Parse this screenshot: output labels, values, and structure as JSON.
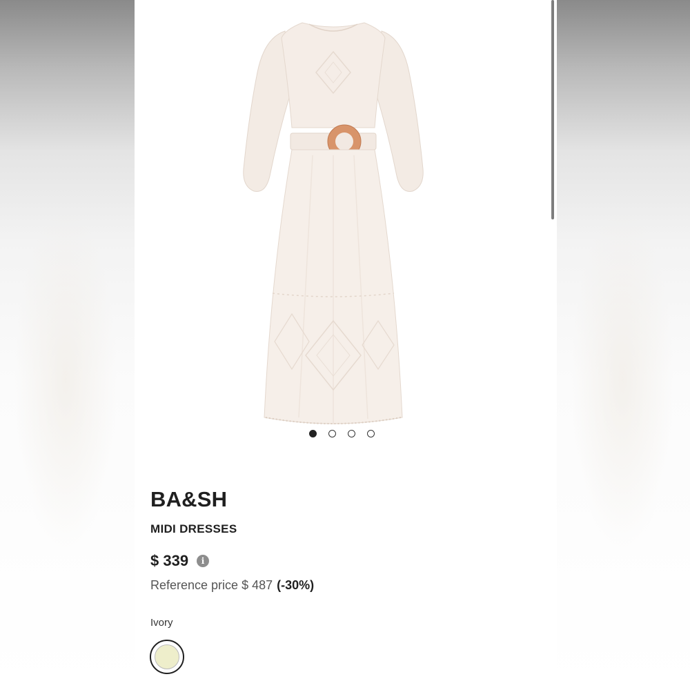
{
  "product": {
    "brand": "BA&SH",
    "category": "MIDI DRESSES",
    "price": "$ 339",
    "reference_label": "Reference price $ 487",
    "discount": "(-30%)",
    "info_icon": "info-icon"
  },
  "gallery": {
    "image_count": 4,
    "active_index": 0
  },
  "color": {
    "name": "Ivory",
    "swatch_hex": "#eeeecb"
  },
  "colors": {
    "dress": "#f4ece6",
    "belt_buckle": "#d8946a",
    "text": "#1f1f1f",
    "muted_text": "#555555"
  }
}
